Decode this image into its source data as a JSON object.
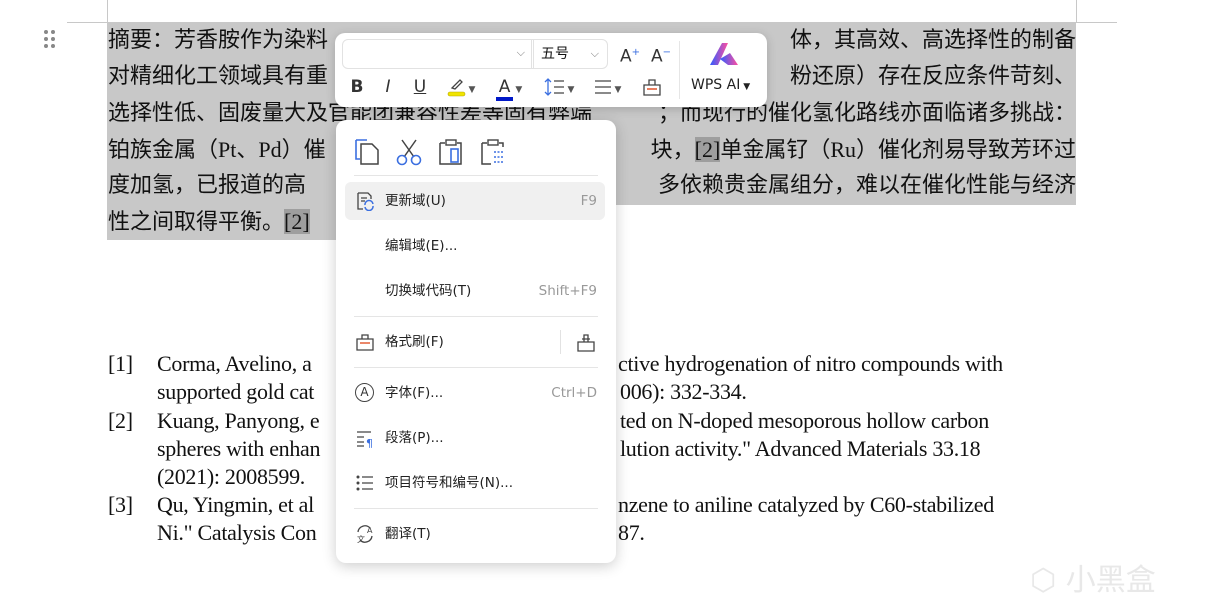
{
  "document": {
    "abstract_lines": [
      {
        "left": "摘要：芳香胺作为染料",
        "right": "体，其高效、高选择性的制备"
      },
      {
        "left": "对精细化工领域具有重",
        "right": "粉还原）存在反应条件苛刻、"
      },
      {
        "left": "选择性低、固废量大及官能团兼容性差等固有弊端",
        "right": "；而现行的催化氢化路线亦面临诸多挑战："
      },
      {
        "left": "铂族金属（Pt、Pd）催",
        "right_pre": "块，",
        "right_field": "[2]",
        "right": "单金属钌（Ru）催化剂易导致芳环过"
      },
      {
        "left": "度加氢，已报道的高",
        "right": "多依赖贵金属组分，难以在催化性能与经济"
      },
      {
        "left": "性之间取得平衡。",
        "field": "[2]"
      }
    ],
    "references": [
      {
        "num": "[1]",
        "line1_left": "Corma, Avelino, a",
        "line1_right": "ctive hydrogenation of nitro compounds with",
        "line2_left": "supported gold cat",
        "line2_right": "006): 332-334."
      },
      {
        "num": "[2]",
        "line1_left": "Kuang, Panyong, e",
        "line1_right": "ted on N-doped mesoporous hollow carbon",
        "line2_left": "spheres with enhan",
        "line2_right": "lution activity.\" Advanced Materials 33.18",
        "line3_left": "(2021): 2008599."
      },
      {
        "num": "[3]",
        "line1_left": "Qu, Yingmin, et al",
        "line1_right": "nzene to aniline catalyzed by C60-stabilized",
        "line2_left": "Ni.\" Catalysis Con",
        "line2_right": "87."
      }
    ]
  },
  "toolbar": {
    "font_name": "",
    "font_size": "五号",
    "grow_font_icon": "font-grow-icon",
    "shrink_font_icon": "font-shrink-icon",
    "bold": "B",
    "italic": "I",
    "underline": "U",
    "highlight_color": "#f0e400",
    "font_color": "#0018c8",
    "font_color_glyph": "A",
    "wps_ai_label": "WPS AI"
  },
  "context_menu": {
    "quick_actions": [
      "copy-icon",
      "cut-icon",
      "paste-icon",
      "paste-special-icon"
    ],
    "items": [
      {
        "label": "更新域(U)",
        "shortcut": "F9",
        "icon": "update-field-icon"
      },
      {
        "label": "编辑域(E)...",
        "shortcut": ""
      },
      {
        "label": "切换域代码(T)",
        "shortcut": "Shift+F9"
      },
      {
        "label": "格式刷(F)",
        "icon": "format-painter-icon"
      },
      {
        "label": "字体(F)...",
        "shortcut": "Ctrl+D",
        "icon": "font-icon",
        "icon_glyph": "A"
      },
      {
        "label": "段落(P)...",
        "icon": "paragraph-icon"
      },
      {
        "label": "项目符号和编号(N)...",
        "icon": "bullets-icon"
      },
      {
        "label": "翻译(T)",
        "icon": "translate-icon"
      }
    ]
  },
  "watermark": "小黑盒",
  "colors": {
    "selection": "#c8c8c8",
    "field_shading": "#9e9e9e",
    "accent": "#3b6fe0"
  }
}
